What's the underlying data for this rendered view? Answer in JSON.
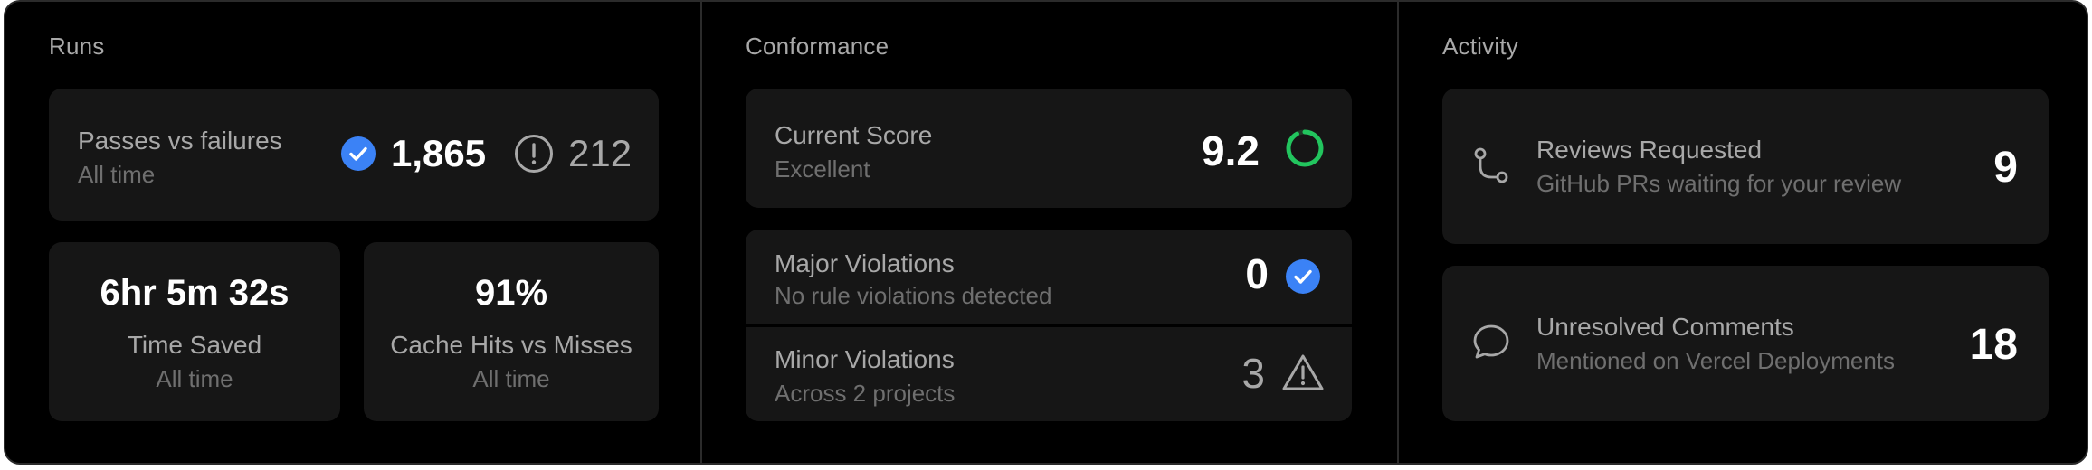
{
  "colors": {
    "background": "#000000",
    "card": "#161616",
    "accent_blue": "#3b82f6",
    "accent_green": "#22c55e",
    "text_primary": "#ffffff",
    "text_secondary": "#a8a8a8",
    "text_muted": "#6f6f6f"
  },
  "runs": {
    "title": "Runs",
    "passes_card": {
      "label": "Passes vs failures",
      "sublabel": "All time",
      "passes_value": "1,865",
      "passes_icon": "check-circle-icon",
      "failures_value": "212",
      "failures_icon": "alert-circle-icon"
    },
    "time_saved": {
      "value": "6hr 5m 32s",
      "label": "Time Saved",
      "sublabel": "All time"
    },
    "cache": {
      "value": "91%",
      "label": "Cache Hits vs Misses",
      "sublabel": "All time"
    }
  },
  "conformance": {
    "title": "Conformance",
    "score_card": {
      "label": "Current Score",
      "sublabel": "Excellent",
      "value": "9.2",
      "ring_fraction": 0.92,
      "icon": "score-ring-icon"
    },
    "major": {
      "label": "Major Violations",
      "sublabel": "No rule violations detected",
      "value": "0",
      "icon": "check-circle-icon"
    },
    "minor": {
      "label": "Minor Violations",
      "sublabel": "Across 2 projects",
      "value": "3",
      "icon": "warning-triangle-icon"
    }
  },
  "activity": {
    "title": "Activity",
    "reviews": {
      "label": "Reviews Requested",
      "sublabel": "GitHub PRs waiting for your review",
      "value": "9",
      "icon": "git-pull-request-icon"
    },
    "comments": {
      "label": "Unresolved Comments",
      "sublabel": "Mentioned on Vercel Deployments",
      "value": "18",
      "icon": "comment-bubble-icon"
    }
  }
}
